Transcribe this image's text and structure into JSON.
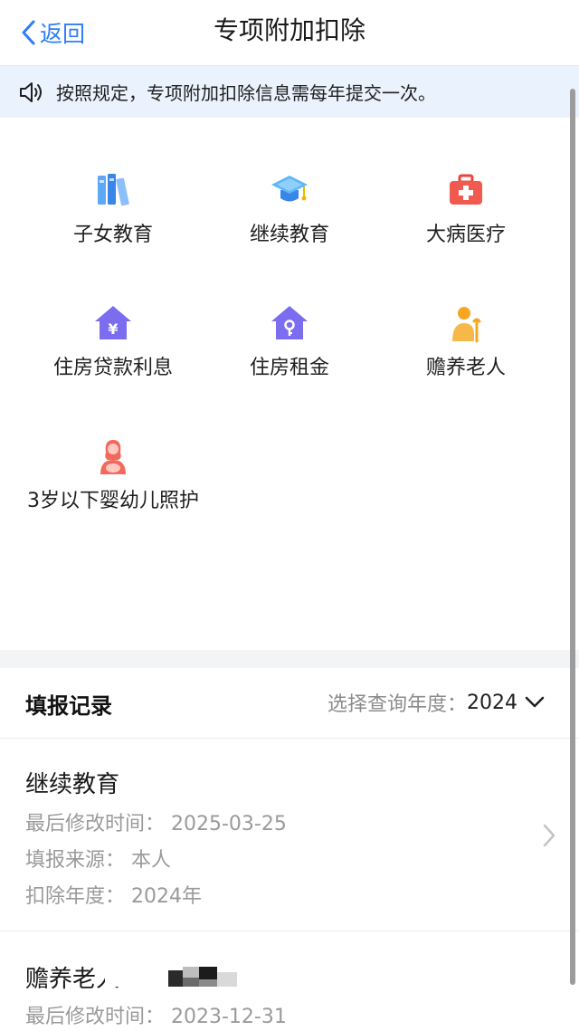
{
  "nav": {
    "back_label": "返回",
    "title": "专项附加扣除"
  },
  "notice": {
    "text": "按照规定，专项附加扣除信息需每年提交一次。"
  },
  "categories": [
    {
      "label": "子女教育",
      "icon": "books-icon"
    },
    {
      "label": "继续教育",
      "icon": "graduation-cap-icon"
    },
    {
      "label": "大病医疗",
      "icon": "medical-kit-icon"
    },
    {
      "label": "住房贷款利息",
      "icon": "house-yuan-icon"
    },
    {
      "label": "住房租金",
      "icon": "house-key-icon"
    },
    {
      "label": "赡养老人",
      "icon": "elderly-person-icon"
    },
    {
      "label": "3岁以下婴幼儿照护",
      "icon": "mother-baby-icon"
    }
  ],
  "records": {
    "title": "填报记录",
    "year_label": "选择查询年度：",
    "year_value": "2024",
    "items": [
      {
        "title": "继续教育",
        "modified": "最后修改时间：  2025-03-25",
        "source": "填报来源：  本人",
        "year": "扣除年度：  2024年"
      },
      {
        "title": "赡养老人",
        "modified": "最后修改时间：  2023-12-31"
      }
    ]
  },
  "colors": {
    "accent": "#2f7df6",
    "notice_bg": "#eaf2fd",
    "secondary_text": "#9a9a9a"
  }
}
